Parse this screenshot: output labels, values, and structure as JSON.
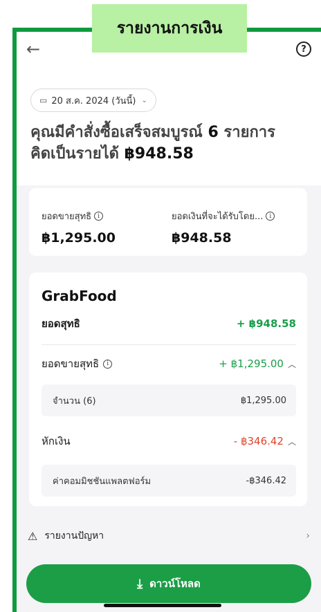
{
  "annotation": {
    "title": "รายงานการเงิน"
  },
  "header": {
    "back_icon": "arrow-left-icon",
    "help_icon": "question-circle-icon"
  },
  "date_filter": {
    "label": "20 ส.ค. 2024 (วันนี้)",
    "icon": "calendar-icon"
  },
  "summary": {
    "line1_prefix": "คุณมีคำสั่งซื้อเสร็จสมบูรณ์ ",
    "line1_count": "6",
    "line1_suffix": " รายการ",
    "line2_prefix": "คิดเป็นรายได้ ",
    "line2_amount": "฿948.58"
  },
  "stats": [
    {
      "label": "ยอดขายสุทธิ",
      "value": "฿1,295.00"
    },
    {
      "label": "ยอดเงินที่จะได้รับโดย...",
      "value": "฿948.58"
    }
  ],
  "breakdown": {
    "title": "GrabFood",
    "net": {
      "label": "ยอดสุทธิ",
      "value": "+ ฿948.58"
    },
    "sales": {
      "label": "ยอดขายสุทธิ",
      "value": "+ ฿1,295.00",
      "item": {
        "label": "จำนวน (6)",
        "value": "฿1,295.00"
      }
    },
    "deductions": {
      "label": "หักเงิน",
      "value": "- ฿346.42",
      "item": {
        "label": "ค่าคอมมิชชันแพลตฟอร์ม",
        "value": "-฿346.42"
      }
    }
  },
  "report_issue": {
    "label": "รายงานปัญหา"
  },
  "download": {
    "label": "ดาวน์โหลด",
    "icon": "download-icon"
  },
  "colors": {
    "brand_green": "#1b9e46",
    "positive": "#1a9e4a",
    "negative": "#e0442c",
    "annotation_bg": "#b8f0a4"
  }
}
